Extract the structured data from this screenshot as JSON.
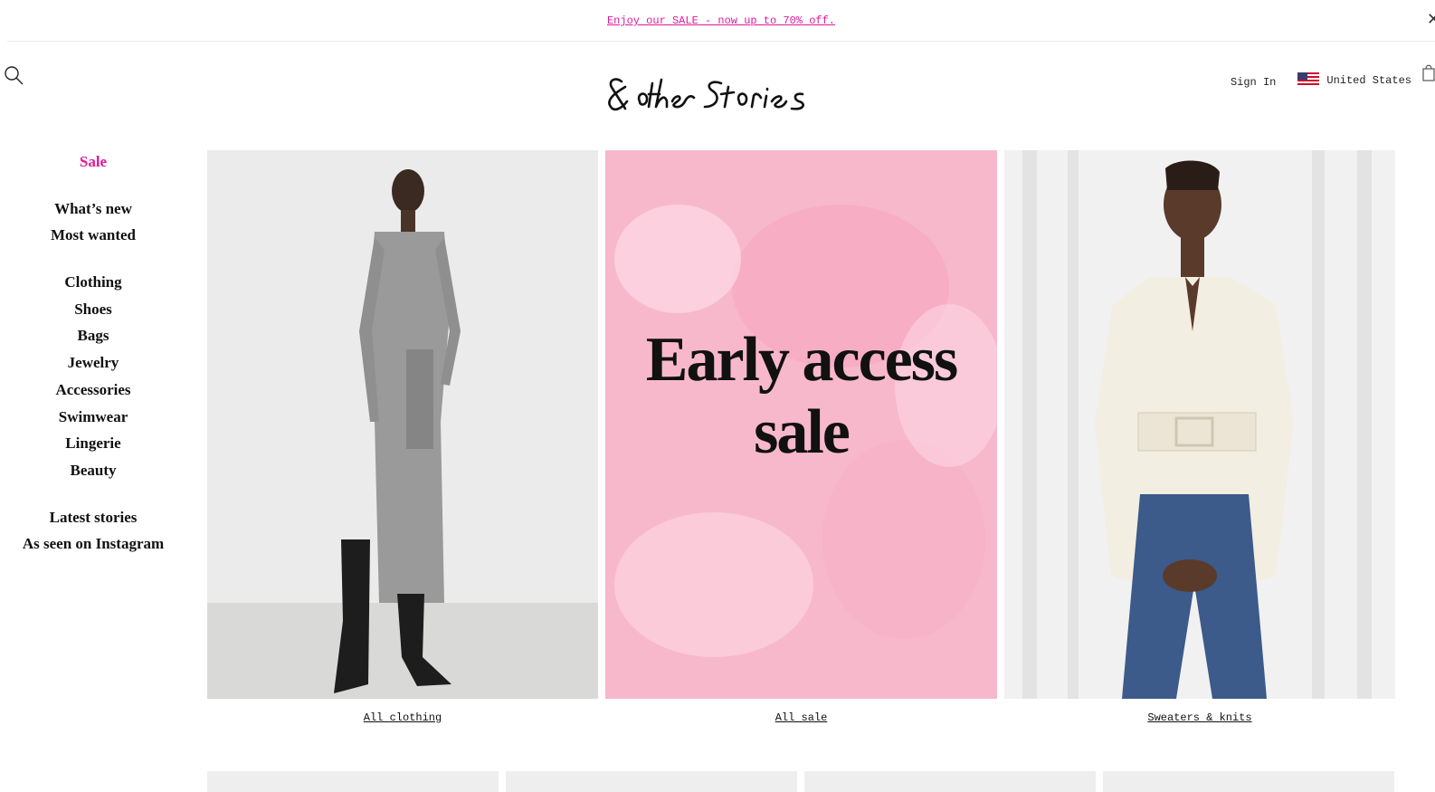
{
  "promo_bar": {
    "text": "Enjoy our SALE - now up to 70% off.",
    "close_icon": "close-icon"
  },
  "header": {
    "logo_text": "& other Stories",
    "search_icon": "search-icon",
    "sign_in": "Sign In",
    "country": "United States",
    "flag_icon": "us-flag-icon",
    "cart_icon": "shopping-bag-icon"
  },
  "sidebar": {
    "items": [
      {
        "label": "Sale"
      },
      {
        "label": "What’s new"
      },
      {
        "label": "Most wanted"
      },
      {
        "label": "Clothing"
      },
      {
        "label": "Shoes"
      },
      {
        "label": "Bags"
      },
      {
        "label": "Jewelry"
      },
      {
        "label": "Accessories"
      },
      {
        "label": "Swimwear"
      },
      {
        "label": "Lingerie"
      },
      {
        "label": "Beauty"
      },
      {
        "label": "Latest stories"
      },
      {
        "label": "As seen on Instagram"
      }
    ]
  },
  "tiles": [
    {
      "caption": "All clothing"
    },
    {
      "caption": "All sale",
      "headline_line1": "Early access",
      "headline_line2": "sale"
    },
    {
      "caption": "Sweaters & knits"
    }
  ],
  "colors": {
    "accent": "#e0199e",
    "sale_bg": "#f8b8cc",
    "text": "#111111"
  }
}
